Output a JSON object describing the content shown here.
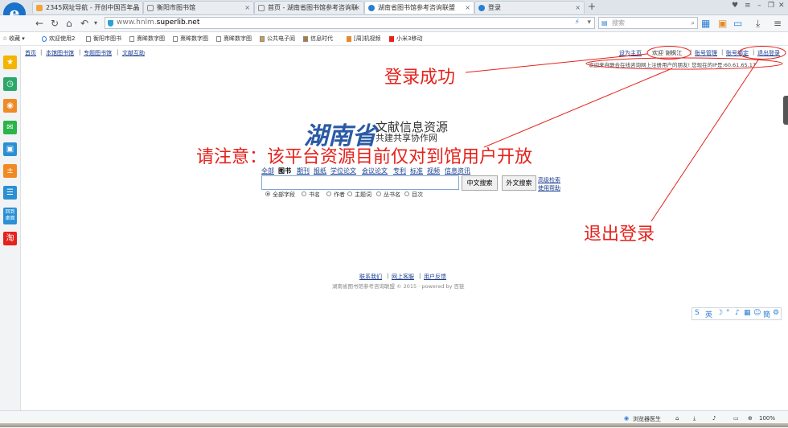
{
  "tabs": [
    {
      "title": "2345网址导航 - 开创中国百年品",
      "active": false
    },
    {
      "title": "衡阳市图书馆",
      "active": false
    },
    {
      "title": "首页 - 湖南省图书馆参考咨询联",
      "active": false
    },
    {
      "title": "湖南省图书馆参考咨询联盟",
      "active": true
    },
    {
      "title": "登录",
      "active": false
    }
  ],
  "address": {
    "prefix": "www.hnlm.",
    "domain": "superlib.net"
  },
  "search": {
    "placeholder": "搜索"
  },
  "bookmarks": {
    "collect_label": "收藏",
    "items": [
      "欢迎使用2",
      "衡阳市图书",
      "熹眸数字图",
      "熹眸数字图",
      "熹眸数字图",
      "公共电子阅",
      "信息时代",
      "[周]机视频",
      "小米3移动"
    ]
  },
  "sidebar": {
    "icons": [
      "star-icon",
      "clock-icon",
      "weibo-icon",
      "wechat-icon",
      "monitor-icon",
      "calculator-icon",
      "notes-icon",
      "desktop-icon",
      "taobao-icon"
    ],
    "desktop_label": "回到桌面",
    "taobao_label": "淘"
  },
  "site": {
    "top_links": [
      "首页",
      "本馆图书馆",
      "专题图书馆",
      "文献互助"
    ],
    "right_links": [
      "设为主页",
      "欢迎 谢枫江",
      "账号管理",
      "账号绑定",
      "退出登录"
    ],
    "welcome_line": "欢迎来自联合在线咨询网上注册用户的朋友! 您现在的IP是:60.61.65.17",
    "brand_script": "湖南省",
    "brand_line1": "文献信息资源",
    "brand_line2": "共建共享协作网",
    "categories": [
      "全部",
      "图书",
      "期刊",
      "报纸",
      "学位论文",
      "会议论文",
      "专利",
      "标准",
      "视频",
      "信息资讯"
    ],
    "active_category": "图书",
    "search_buttons": {
      "cn": "中文搜索",
      "foreign": "外文搜索"
    },
    "advanced": "高级检索",
    "help": "使用帮助",
    "radio_options": [
      "全部字段",
      "书名",
      "作者",
      "主题词",
      "丛书名",
      "目次"
    ],
    "footer_links": [
      "联系我们",
      "网上客服",
      "用户反馈"
    ],
    "copyright": "湖南省图书馆参考咨询联盟 © 2015 · powered by 百链"
  },
  "annotations": {
    "login_success": "登录成功",
    "notice": "请注意：该平台资源目前仅对到馆用户开放",
    "logout": "退出登录"
  },
  "ime": {
    "label": "英"
  },
  "status": {
    "doctor": "浏览器医生",
    "zoom": "100%"
  },
  "colors": {
    "annotation": "#e5221c",
    "link": "#1a3d8f",
    "brand": "#2a5aa5"
  }
}
